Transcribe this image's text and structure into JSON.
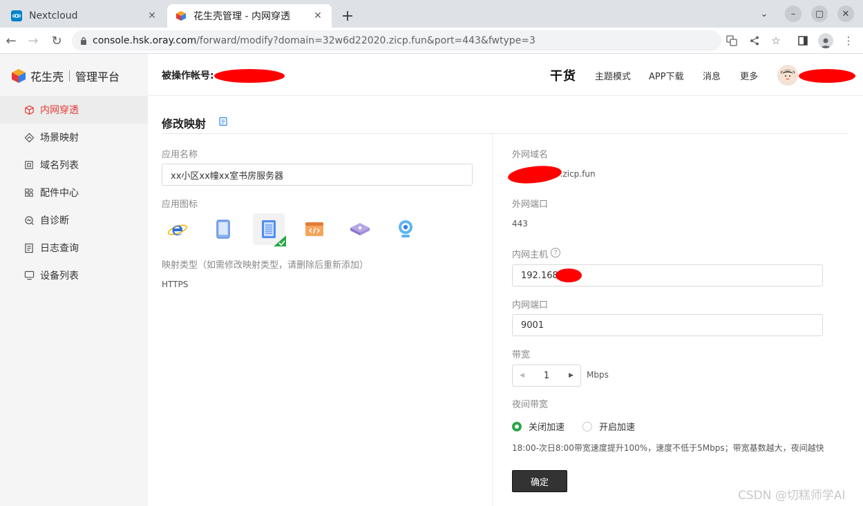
{
  "browser": {
    "tabs": [
      {
        "title": "Nextcloud",
        "active": false
      },
      {
        "title": "花生壳管理 - 内网穿透",
        "active": true
      }
    ],
    "url_host": "console.hsk.oray.com",
    "url_path": "/forward/modify?domain=32w6d22020.zicp.fun&port=443&fwtype=3"
  },
  "sidebar": {
    "brand_name": "花生壳",
    "brand_sub": "管理平台",
    "items": [
      {
        "label": "内网穿透",
        "icon": "cube-icon",
        "active": true
      },
      {
        "label": "场景映射",
        "icon": "scene-icon",
        "active": false
      },
      {
        "label": "域名列表",
        "icon": "domain-icon",
        "active": false
      },
      {
        "label": "配件中心",
        "icon": "grid-icon",
        "active": false
      },
      {
        "label": "自诊断",
        "icon": "diagnose-icon",
        "active": false
      },
      {
        "label": "日志查询",
        "icon": "log-icon",
        "active": false
      },
      {
        "label": "设备列表",
        "icon": "monitor-icon",
        "active": false
      }
    ]
  },
  "header": {
    "account_label": "被操作帐号:",
    "ganhuo": "干货",
    "links": [
      "主题模式",
      "APP下载",
      "消息",
      "更多"
    ]
  },
  "form": {
    "title": "修改映射",
    "app_name_label": "应用名称",
    "app_name_value": "xx小区xx幢xx室书房服务器",
    "app_icon_label": "应用图标",
    "mapping_type_label": "映射类型（如需修改映射类型，请删除后重新添加）",
    "mapping_type_value": "HTTPS",
    "ext_domain_label": "外网域名",
    "ext_domain_value": "0.zicp.fun",
    "ext_port_label": "外网端口",
    "ext_port_value": "443",
    "int_host_label": "内网主机",
    "int_host_value": "192.168.",
    "int_port_label": "内网端口",
    "int_port_value": "9001",
    "bandwidth_label": "带宽",
    "bandwidth_value": "1",
    "bandwidth_unit": "Mbps",
    "night_label": "夜间带宽",
    "night_off": "关闭加速",
    "night_on": "开启加速",
    "night_desc": "18:00-次日8:00带宽速度提升100%，速度不低于5Mbps；带宽基数越大，夜间越快",
    "submit": "确定"
  },
  "colors": {
    "accent_red": "#e53935",
    "radio_green": "#2aa74a",
    "button_dark": "#333333"
  },
  "watermark": "CSDN @切糕师学AI"
}
